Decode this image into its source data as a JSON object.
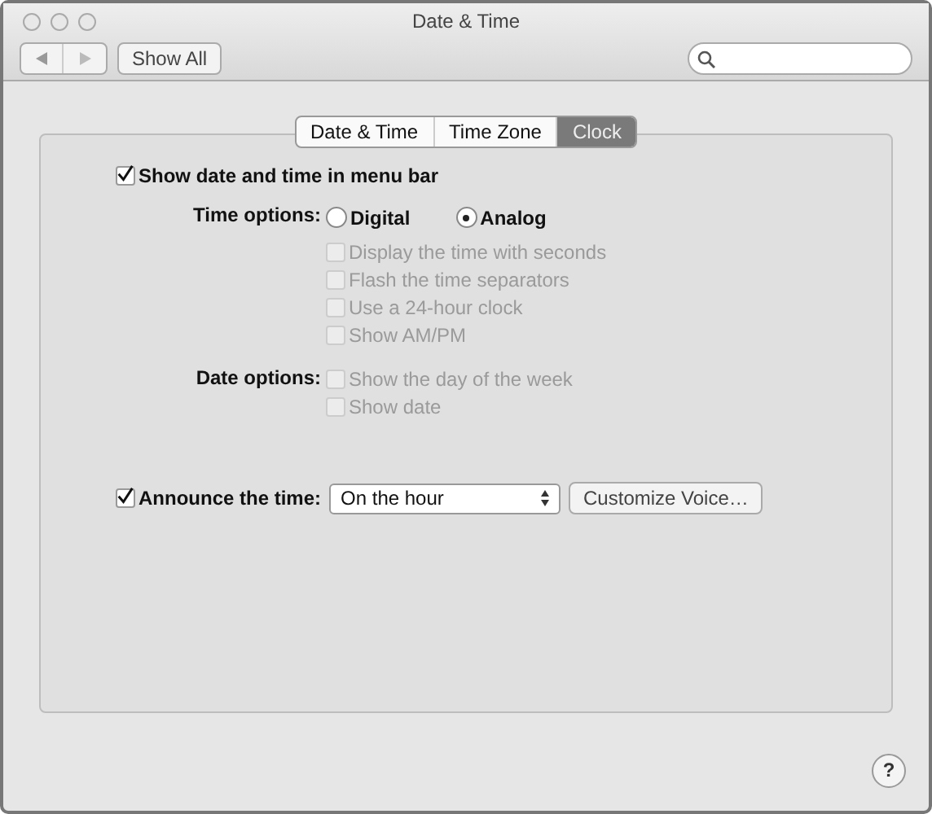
{
  "window": {
    "title": "Date & Time"
  },
  "toolbar": {
    "show_all_button": "Show All"
  },
  "tabs": [
    {
      "label": "Date & Time",
      "selected": false
    },
    {
      "label": "Time Zone",
      "selected": false
    },
    {
      "label": "Clock",
      "selected": true
    }
  ],
  "menu_bar_option": {
    "label": "Show date and time in menu bar",
    "checked": true
  },
  "time_options": {
    "label": "Time options:",
    "radios": [
      {
        "label": "Digital",
        "selected": false
      },
      {
        "label": "Analog",
        "selected": true
      }
    ],
    "checkboxes": [
      {
        "label": "Display the time with seconds",
        "checked": false,
        "disabled": true
      },
      {
        "label": "Flash the time separators",
        "checked": false,
        "disabled": true
      },
      {
        "label": "Use a 24-hour clock",
        "checked": false,
        "disabled": true
      },
      {
        "label": "Show AM/PM",
        "checked": false,
        "disabled": true
      }
    ]
  },
  "date_options": {
    "label": "Date options:",
    "checkboxes": [
      {
        "label": "Show the day of the week",
        "checked": false,
        "disabled": true
      },
      {
        "label": "Show date",
        "checked": false,
        "disabled": true
      }
    ]
  },
  "announce": {
    "label": "Announce the time:",
    "checked": true,
    "select_value": "On the hour",
    "button": "Customize Voice…"
  },
  "help_button": "?"
}
